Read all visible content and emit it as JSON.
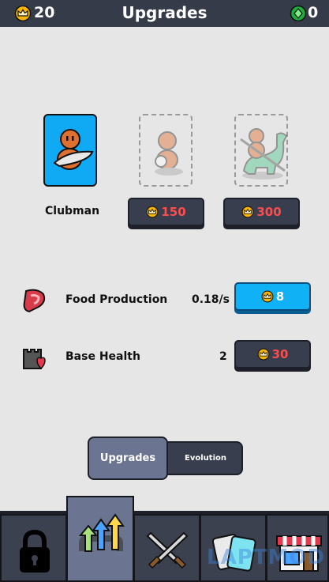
{
  "header": {
    "crowns": "20",
    "title": "Upgrades",
    "gems": "0"
  },
  "units": {
    "clubman_label": "Clubman",
    "slinger_price": "150",
    "rider_price": "300"
  },
  "upgrades": [
    {
      "label": "Food Production",
      "value": "0.18/s",
      "price": "8"
    },
    {
      "label": "Base Health",
      "value": "2",
      "price": "30"
    }
  ],
  "toggle": {
    "upgrades_label": "Upgrades",
    "evolution_label": "Evolution"
  },
  "tabs": [
    "lock-icon",
    "upgrades-arrows-icon",
    "crossed-swords-icon",
    "cards-icon",
    "shop-icon"
  ],
  "watermark": "LAPTMOD",
  "colors": {
    "header_bg": "#363b4a",
    "accent_blue": "#10b1f5",
    "price_red": "#ff4c4c",
    "active_tab": "#6b7591"
  }
}
